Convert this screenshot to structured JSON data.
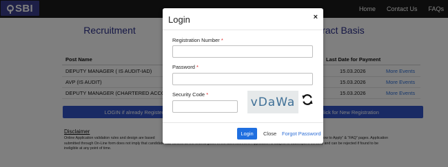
{
  "header": {
    "logo_text": "SBI",
    "nav": [
      "Home",
      "Contact Us",
      "FAQs"
    ]
  },
  "page": {
    "title_left": "Recruitment",
    "title_right": "ontract Basis"
  },
  "table": {
    "headers": [
      "Post Name",
      "Last Date for Payment"
    ],
    "rows": [
      {
        "post": "DEPUTY MANAGER ( IS AUDIT-IAD)",
        "date": "15.03.2026",
        "link": "More Events"
      },
      {
        "post": "AVP (IS AUDIT)",
        "date": "15.03.2026",
        "link": "More Events"
      },
      {
        "post": "DEPUTY MANAGER (CHARTERED ACCOUNTAN",
        "date": "15.03.2026",
        "link": "More Events"
      }
    ]
  },
  "buttons": {
    "login_registered": "LOGIN if already Registere",
    "new_registration": "lick for New Registration"
  },
  "disclaimer": {
    "title": "Disclaimer",
    "line1_left": "Online Application validation rules and design are based",
    "line1_right": "ply and refer “How to Apply” & “FAQ” pages. Application",
    "line2": "submitted through On-Line form does not imply that candidate has fulfilled all the criteria given in the advertisement. Application is subject to subsequent scrutiny and can be rejected if found to be",
    "line3": "ineligible at any point of time."
  },
  "login_modal": {
    "title": "Login",
    "close_symbol": "×",
    "registration_label": "Registration Number",
    "registration_value": "",
    "password_label": "Password",
    "password_value": "",
    "security_label": "Security Code",
    "security_value": "",
    "required_mark": "*",
    "captcha_text": "vDaWa",
    "login_button": "Login",
    "close_button": "Close",
    "forgot_link": "Forgot Password"
  },
  "colors": {
    "brand": "#3a3f8f",
    "primary_button": "#1f6fe0",
    "link": "#2f6fd6",
    "required": "#dd2222"
  }
}
